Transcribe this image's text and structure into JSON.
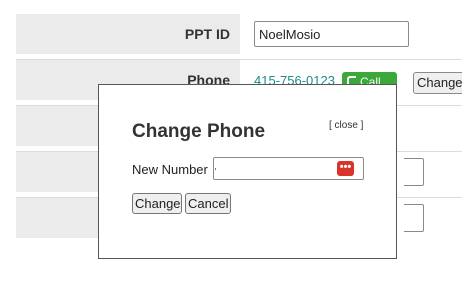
{
  "form": {
    "ppt_id_label": "PPT ID",
    "ppt_id_value": "NoelMosio",
    "phone_label": "Phone",
    "phone_number": "415-756-0123",
    "call_label": "Call",
    "change_label": "Change"
  },
  "modal": {
    "title": "Change Phone",
    "close_label": "[ close ]",
    "new_number_label": "New Number",
    "new_number_value": "",
    "password_manager_icon": "ellipsis-key-icon",
    "change_button": "Change",
    "cancel_button": "Cancel"
  },
  "colors": {
    "label_bg": "#ebebeb",
    "phone_link": "#1f8a8a",
    "call_green": "#3aa83a",
    "pw_icon_red": "#d8342c"
  }
}
